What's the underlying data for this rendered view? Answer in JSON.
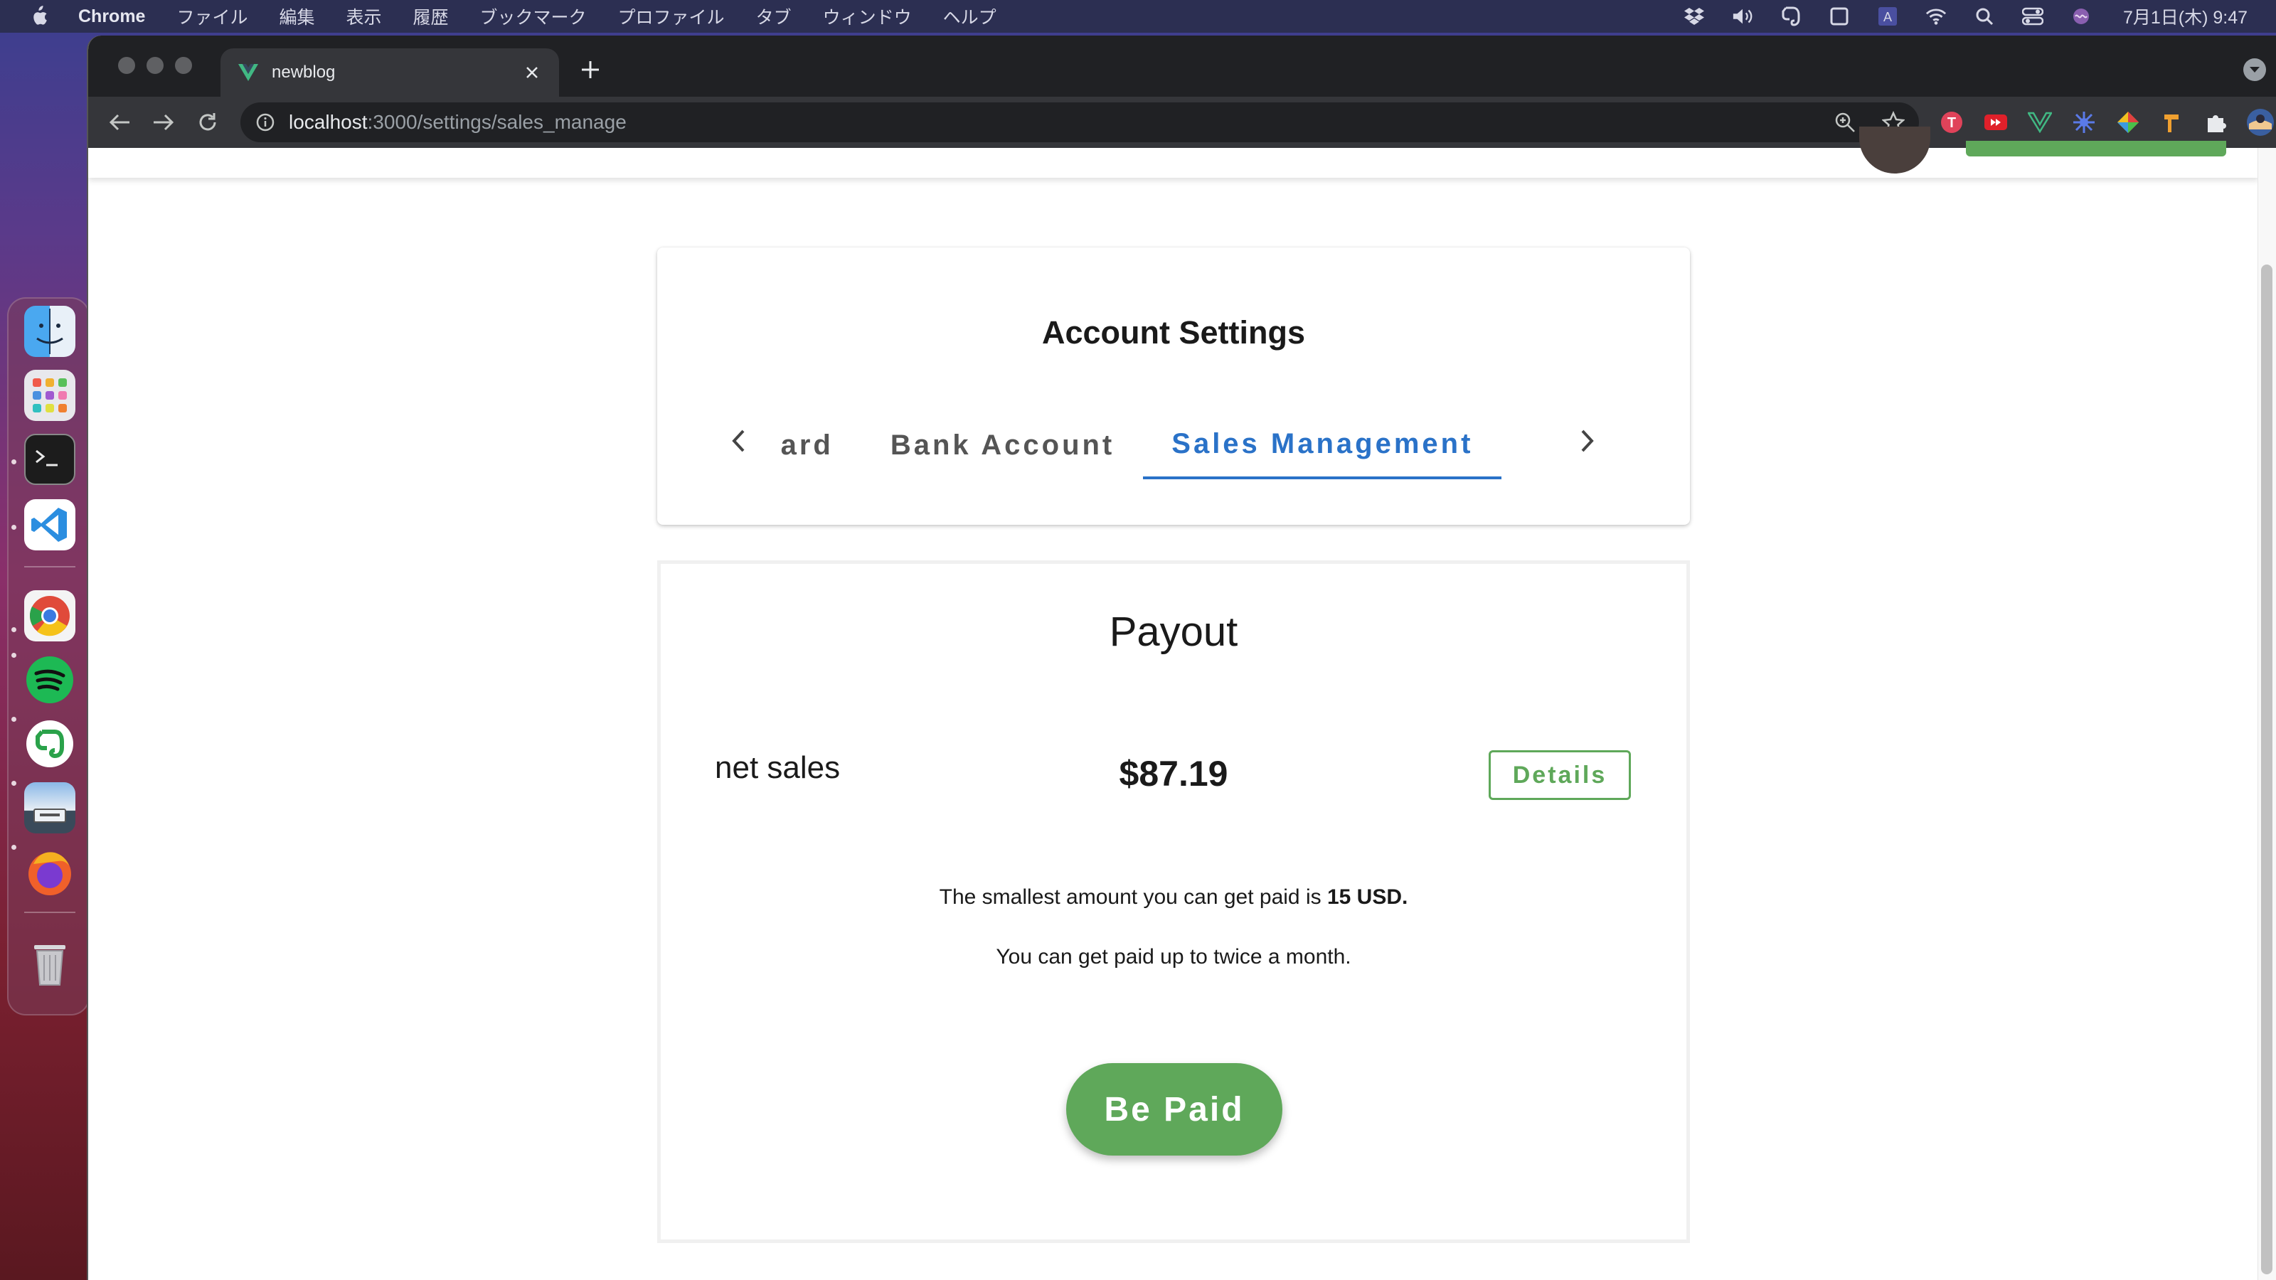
{
  "menubar": {
    "app_name": "Chrome",
    "items": [
      "ファイル",
      "編集",
      "表示",
      "履歴",
      "ブックマーク",
      "プロファイル",
      "タブ",
      "ウィンドウ",
      "ヘルプ"
    ],
    "clock": "7月1日(木) 9:47",
    "status_icons": [
      "dropbox-icon",
      "volume-icon",
      "evernote-icon",
      "window-icon",
      "input-source-icon",
      "wifi-icon",
      "spotlight-icon",
      "control-center-icon",
      "siri-icon"
    ]
  },
  "dock": {
    "apps": [
      "finder-icon",
      "launchpad-icon",
      "terminal-icon",
      "vscode-icon",
      "chrome-icon",
      "spotify-icon",
      "evernote-icon",
      "preview-icon",
      "firefox-icon",
      "trash-icon"
    ]
  },
  "browser": {
    "tab_title": "newblog",
    "url_host": "localhost",
    "url_rest": ":3000/settings/sales_manage"
  },
  "settings": {
    "title": "Account Settings",
    "tabs": [
      "Credit Card",
      "Bank Account",
      "Sales Management"
    ],
    "active_tab": "Sales Management"
  },
  "payout": {
    "title": "Payout",
    "net_sales_label": "net sales",
    "net_sales_value": "$87.19",
    "details_label": "Details",
    "notice_prefix": "The smallest amount you can get paid is ",
    "notice_min": "15 USD.",
    "notice_frequency": "You can get paid up to twice a month.",
    "pay_button_label": "Be Paid"
  },
  "colors": {
    "accent_green": "#5fa85a",
    "tab_active_blue": "#2a72c8"
  }
}
